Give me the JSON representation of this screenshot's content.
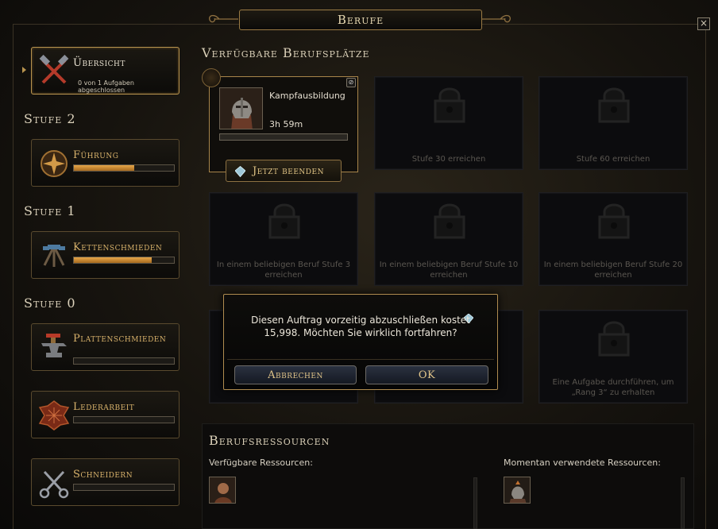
{
  "window": {
    "title": "Berufe",
    "close_glyph": "×"
  },
  "sidebar": {
    "overview": {
      "label": "Übersicht",
      "sub": "0 von 1 Aufgaben abgeschlossen"
    },
    "tiers": [
      {
        "label": "Stufe 2"
      },
      {
        "label": "Stufe 1"
      },
      {
        "label": "Stufe 0"
      }
    ],
    "professions": [
      {
        "label": "Führung",
        "progress": 0.6,
        "icon": "leadership-icon"
      },
      {
        "label": "Kettenschmieden",
        "progress": 0.78,
        "icon": "hammers-icon"
      },
      {
        "label": "Plattenschmieden",
        "progress": 0.0,
        "icon": "anvil-icon"
      },
      {
        "label": "Lederarbeit",
        "progress": 0.0,
        "icon": "leather-icon"
      },
      {
        "label": "Schneidern",
        "progress": 0.0,
        "icon": "scissors-icon"
      }
    ]
  },
  "slots": {
    "title": "Verfügbare Berufsplätze",
    "active": {
      "task": "Kampfausbildung",
      "time": "3h 59m",
      "progress": 0.0,
      "finish_label": "Jetzt beenden"
    },
    "locked": [
      "Stufe 30 erreichen",
      "Stufe 60 erreichen",
      "In einem beliebigen Beruf Stufe 3 erreichen",
      "In einem beliebigen Beruf Stufe 10 erreichen",
      "In einem beliebigen Beruf Stufe 20 erreichen",
      "Eine Aufgabe durchführen, um „Rang 3“ zu erhalten"
    ]
  },
  "resources": {
    "title": "Berufsressourcen",
    "available_label": "Verfügbare Ressourcen:",
    "in_use_label": "Momentan verwendete Ressourcen:"
  },
  "dialog": {
    "text": "Diesen Auftrag vorzeitig abzuschließen kostet 15,998. Möchten Sie wirklich fortfahren?",
    "cancel_label": "Abbrechen",
    "ok_label": "OK",
    "currency_icon": "astral-diamond-icon"
  },
  "colors": {
    "accent_gold": "#d8b26b",
    "bar_fill": "#e6a74a",
    "frame": "#b08c50"
  }
}
